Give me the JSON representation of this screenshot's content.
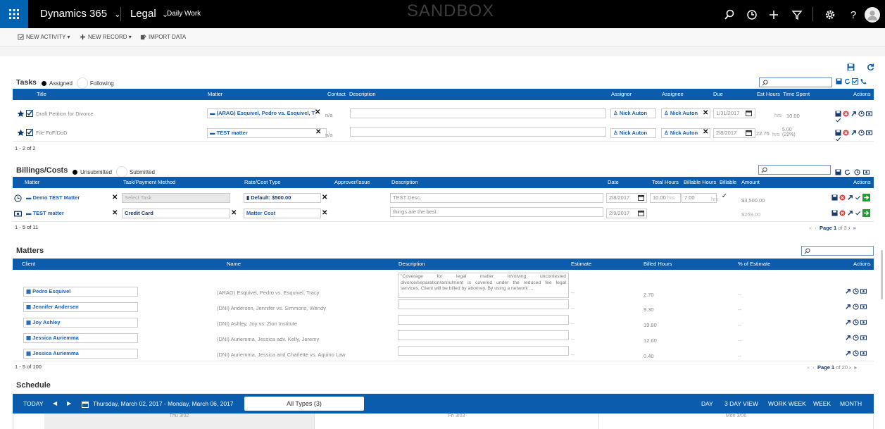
{
  "topbar": {
    "app_name": "Dynamics 365",
    "area": "Legal",
    "page": "Daily Work",
    "environment": "SANDBOX",
    "chevron": "⌄"
  },
  "commands": {
    "new_activity": "NEW ACTIVITY",
    "new_record": "NEW RECORD",
    "import_data": "IMPORT DATA",
    "dropdown_arrow": "▾"
  },
  "tasks": {
    "title": "Tasks",
    "filter_assigned": "Assigned",
    "filter_following": "Following",
    "columns": {
      "title": "Title",
      "matter": "Matter",
      "contact": "Contact",
      "description": "Description",
      "assignor": "Assignor",
      "assignee": "Assignee",
      "due": "Due",
      "est_hours": "Est Hours",
      "time_spent": "Time Spent",
      "actions": "Actions"
    },
    "rows": [
      {
        "title": "Draft Petition for Divorce",
        "matter": "(ARAG) Esquivel, Pedro vs. Esquivel, Trz",
        "contact": "n/a",
        "assignor": "Nick Auton",
        "assignee": "Nick Auton",
        "due": "1/31/2017",
        "est_hours": "",
        "hrs": "hrs",
        "time_spent": "10.00",
        "time_pct": ""
      },
      {
        "title": "File FoF/DoD",
        "matter": "TEST matter",
        "contact": "n/a",
        "assignor": "Nick Auton",
        "assignee": "Nick Auton",
        "due": "2/8/2017",
        "est_hours": "22.75",
        "hrs": "hrs",
        "time_spent": "5.00",
        "time_pct": "(22%)"
      }
    ],
    "pagination": "1 - 2 of 2"
  },
  "billings": {
    "title": "Billings/Costs",
    "filter_unsubmitted": "Unsubmitted",
    "filter_submitted": "Submitted",
    "columns": {
      "matter": "Matter",
      "task_payment": "Task/Payment Method",
      "rate_cost": "Rate/Cost Type",
      "approver": "Approver/Issue",
      "description": "Description",
      "date": "Date",
      "total_hours": "Total Hours",
      "billable_hours": "Billable Hours",
      "billable": "Billable",
      "amount": "Amount",
      "actions": "Actions"
    },
    "rows": [
      {
        "matter": "Demo TEST Matter",
        "task": "Select Task",
        "rate": "Default: $500.00",
        "description": "TEST Desc.",
        "date": "2/8/2017",
        "total_hours": "10.00",
        "hrs": "hrs",
        "billable_hours": "7.00",
        "amount": "$3,500.00"
      },
      {
        "matter": "TEST matter",
        "task": "Credit Card",
        "rate": "Matter Cost",
        "description": "things are the best",
        "date": "2/9/2017",
        "total_hours": "",
        "hrs": "",
        "billable_hours": "",
        "amount": "$259.00"
      }
    ],
    "pagination": "1 - 5 of 11",
    "pager": {
      "page_label": "Page",
      "page": "1",
      "of": "of 3"
    }
  },
  "matters": {
    "title": "Matters",
    "columns": {
      "client": "Client",
      "name": "Name",
      "description": "Description",
      "estimate": "Estimate",
      "billed_hours": "Billed Hours",
      "pct_estimate": "% of Estimate",
      "actions": "Actions"
    },
    "rows": [
      {
        "client": "Pedro Esquivel",
        "name": "(ARAG) Esquivel, Pedro vs. Esquivel, Tracy",
        "description": "\"Coverage for legal matter involving uncontested divorce/separation/annulment is covered under the reduced fee legal services. Client will be billed by attorney. By using a network ...",
        "estimate": "--",
        "billed": "2.70",
        "pct": "--"
      },
      {
        "client": "Jennifer Andersen",
        "name": "(DNI) Andersen, Jennifer vs. Simmons, Wendy",
        "description": "",
        "estimate": "--",
        "billed": "9.30",
        "pct": "--"
      },
      {
        "client": "Joy Ashley",
        "name": "(DNI) Ashley, Joy vs. Zion Institute",
        "description": "",
        "estimate": "--",
        "billed": "19.80",
        "pct": "--"
      },
      {
        "client": "Jessica Auriemma",
        "name": "(DNI) Auriemma, Jessica adv. Kelly, Jeremy",
        "description": "",
        "estimate": "--",
        "billed": "12.60",
        "pct": "--"
      },
      {
        "client": "Jessica Auriemma",
        "name": "(DNI) Auriemma, Jessica and Charlette vs. Aquino Law",
        "description": "",
        "estimate": "--",
        "billed": "0.40",
        "pct": "--"
      }
    ],
    "pagination": "1 - 5 of 100",
    "pager": {
      "page_label": "Page",
      "page": "1",
      "of": "of 20"
    }
  },
  "schedule": {
    "title": "Schedule",
    "today": "TODAY",
    "range": "Thursday, March 02, 2017 - Monday, March 06, 2017",
    "types": "All Types (3)",
    "views": [
      "DAY",
      "3 DAY VIEW",
      "WORK WEEK",
      "WEEK",
      "MONTH"
    ],
    "days": [
      "Thu 3/02",
      "Fri 3/03",
      "Mon 3/06"
    ]
  },
  "colors": {
    "accent": "#0b5cad",
    "link": "#1a5fb4",
    "waffle": "#0063b1",
    "delete": "#e04040",
    "go": "#1e9e2e"
  },
  "icons": [
    "waffle-icon",
    "search-icon",
    "history-icon",
    "plus-icon",
    "filter-icon",
    "gear-icon",
    "help-icon",
    "avatar-icon",
    "save-icon",
    "refresh-icon",
    "check-icon",
    "phone-icon",
    "star-icon",
    "case-icon",
    "person-icon",
    "calendar-icon",
    "delete-icon",
    "open-icon",
    "clock-icon",
    "timer-icon",
    "go-icon",
    "arrow-icon"
  ]
}
